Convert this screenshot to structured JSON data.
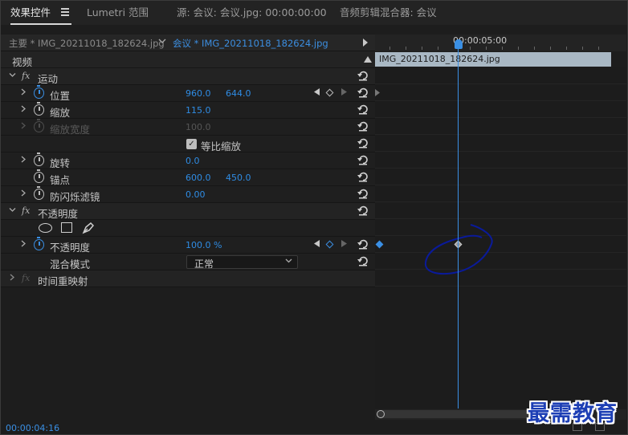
{
  "panel_tabs": [
    {
      "label": "效果控件",
      "active": true
    },
    {
      "label": "Lumetri 范围",
      "active": false
    },
    {
      "label": "源: 会议: 会议.jpg: 00:00:00:00",
      "active": false
    },
    {
      "label": "音频剪辑混合器: 会议",
      "active": false
    }
  ],
  "sub_tabs": {
    "master": "主要 * IMG_20211018_182624.jpg",
    "sequence": "会议 * IMG_20211018_182624.jpg"
  },
  "timeline": {
    "ruler_time": "00:00:05:00",
    "clip_name": "IMG_20211018_182624.jpg"
  },
  "properties": {
    "video_header": "视频",
    "motion": {
      "label": "运动",
      "position": {
        "label": "位置",
        "x": "960.0",
        "y": "644.0"
      },
      "scale": {
        "label": "缩放",
        "value": "115.0"
      },
      "scale_width": {
        "label": "缩放宽度",
        "value": "100.0"
      },
      "uniform_scale": {
        "label": "等比缩放",
        "checked": true
      },
      "rotation": {
        "label": "旋转",
        "value": "0.0"
      },
      "anchor": {
        "label": "锚点",
        "x": "600.0",
        "y": "450.0"
      },
      "anti_flicker": {
        "label": "防闪烁滤镜",
        "value": "0.00"
      }
    },
    "opacity": {
      "label": "不透明度",
      "opacity": {
        "label": "不透明度",
        "value": "100.0 %"
      },
      "blend_mode": {
        "label": "混合模式",
        "value": "正常"
      }
    },
    "time_remap": {
      "label": "时间重映射"
    }
  },
  "status": {
    "current_time": "00:00:04:16"
  },
  "watermark": "最需教育",
  "colors": {
    "accent_blue": "#3a8fe4",
    "clip_bar": "#a9b8c4",
    "watermark": "#1d3fb5",
    "annotation": "#0a1a9a"
  }
}
